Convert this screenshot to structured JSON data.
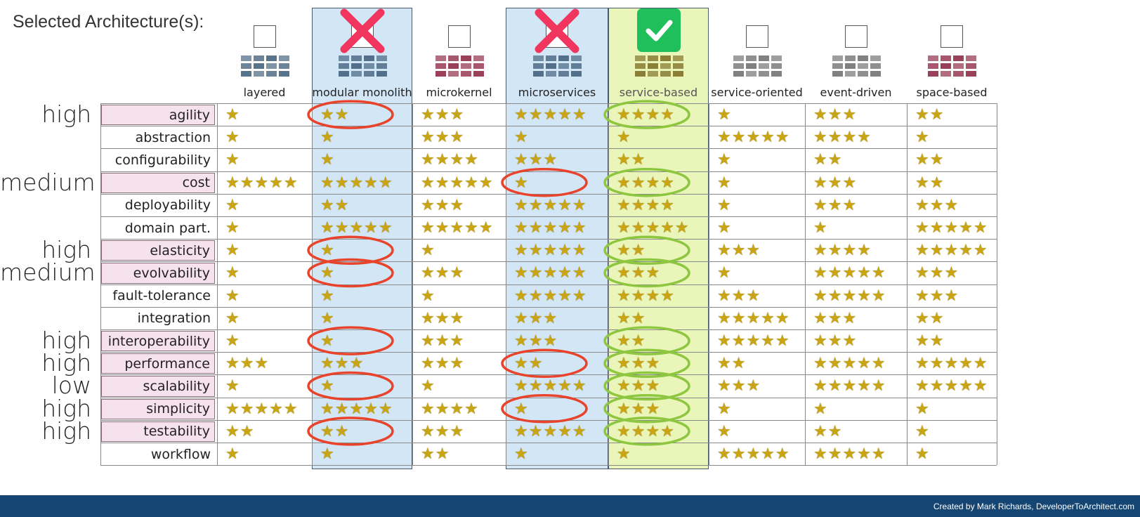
{
  "header": {
    "title": "Selected Architecture(s):"
  },
  "columns": [
    {
      "name": "layered",
      "status": "unselected",
      "thumb_color": "#3b5a78"
    },
    {
      "name": "modular monolith",
      "status": "rejected",
      "thumb_color": "#3b5a78"
    },
    {
      "name": "microkernel",
      "status": "unselected",
      "thumb_color": "#8a1e3c"
    },
    {
      "name": "microservices",
      "status": "rejected",
      "thumb_color": "#3b5a78"
    },
    {
      "name": "service-based",
      "status": "selected",
      "thumb_color": "#7a6a20"
    },
    {
      "name": "service-oriented",
      "status": "unselected",
      "thumb_color": "#6a6a6a"
    },
    {
      "name": "event-driven",
      "status": "unselected",
      "thumb_color": "#6a6a6a"
    },
    {
      "name": "space-based",
      "status": "unselected",
      "thumb_color": "#8a1e3c"
    }
  ],
  "rows": [
    {
      "attribute": "agility",
      "priority": "high",
      "highlighted": true,
      "ratings": [
        1,
        2,
        3,
        5,
        4,
        1,
        3,
        2
      ]
    },
    {
      "attribute": "abstraction",
      "priority": "",
      "highlighted": false,
      "ratings": [
        1,
        1,
        3,
        1,
        1,
        5,
        4,
        1
      ]
    },
    {
      "attribute": "configurability",
      "priority": "",
      "highlighted": false,
      "ratings": [
        1,
        1,
        4,
        3,
        2,
        1,
        2,
        2
      ]
    },
    {
      "attribute": "cost",
      "priority": "medium",
      "highlighted": true,
      "ratings": [
        5,
        5,
        5,
        1,
        4,
        1,
        3,
        2
      ]
    },
    {
      "attribute": "deployability",
      "priority": "",
      "highlighted": false,
      "ratings": [
        1,
        2,
        3,
        5,
        4,
        1,
        3,
        3
      ]
    },
    {
      "attribute": "domain part.",
      "priority": "",
      "highlighted": false,
      "ratings": [
        1,
        5,
        5,
        5,
        5,
        1,
        1,
        5
      ]
    },
    {
      "attribute": "elasticity",
      "priority": "high",
      "highlighted": true,
      "ratings": [
        1,
        1,
        1,
        5,
        2,
        3,
        4,
        5
      ]
    },
    {
      "attribute": "evolvability",
      "priority": "medium",
      "highlighted": true,
      "ratings": [
        1,
        1,
        3,
        5,
        3,
        1,
        5,
        3
      ]
    },
    {
      "attribute": "fault-tolerance",
      "priority": "",
      "highlighted": false,
      "ratings": [
        1,
        1,
        1,
        5,
        4,
        3,
        5,
        3
      ]
    },
    {
      "attribute": "integration",
      "priority": "",
      "highlighted": false,
      "ratings": [
        1,
        1,
        3,
        3,
        2,
        5,
        3,
        2
      ]
    },
    {
      "attribute": "interoperability",
      "priority": "high",
      "highlighted": true,
      "ratings": [
        1,
        1,
        3,
        3,
        2,
        5,
        3,
        2
      ]
    },
    {
      "attribute": "performance",
      "priority": "high",
      "highlighted": true,
      "ratings": [
        3,
        3,
        3,
        2,
        3,
        2,
        5,
        5
      ]
    },
    {
      "attribute": "scalability",
      "priority": "low",
      "highlighted": true,
      "ratings": [
        1,
        1,
        1,
        5,
        3,
        3,
        5,
        5
      ]
    },
    {
      "attribute": "simplicity",
      "priority": "high",
      "highlighted": true,
      "ratings": [
        5,
        5,
        4,
        1,
        3,
        1,
        1,
        1
      ]
    },
    {
      "attribute": "testability",
      "priority": "high",
      "highlighted": true,
      "ratings": [
        2,
        2,
        3,
        5,
        4,
        1,
        2,
        1
      ]
    },
    {
      "attribute": "workflow",
      "priority": "",
      "highlighted": false,
      "ratings": [
        1,
        1,
        2,
        1,
        1,
        5,
        5,
        1
      ]
    }
  ],
  "circles": {
    "red": [
      [
        0,
        1
      ],
      [
        6,
        1
      ],
      [
        7,
        1
      ],
      [
        10,
        1
      ],
      [
        12,
        1
      ],
      [
        14,
        1
      ],
      [
        3,
        3
      ],
      [
        11,
        3
      ],
      [
        13,
        3
      ]
    ],
    "green": [
      [
        0,
        4
      ],
      [
        3,
        4
      ],
      [
        6,
        4
      ],
      [
        7,
        4
      ],
      [
        10,
        4
      ],
      [
        11,
        4
      ],
      [
        12,
        4
      ],
      [
        13,
        4
      ],
      [
        14,
        4
      ]
    ]
  },
  "colors": {
    "highlight_blue": "#d3e6f6",
    "highlight_green": "#eaf5b9",
    "circle_red": "#e8432b",
    "circle_green": "#8dc63f",
    "check_green": "#1fbf5b",
    "cross_red": "#f0355f",
    "footer": "#154572"
  },
  "footer": {
    "credit": "Created by Mark Richards, DeveloperToArchitect.com"
  }
}
